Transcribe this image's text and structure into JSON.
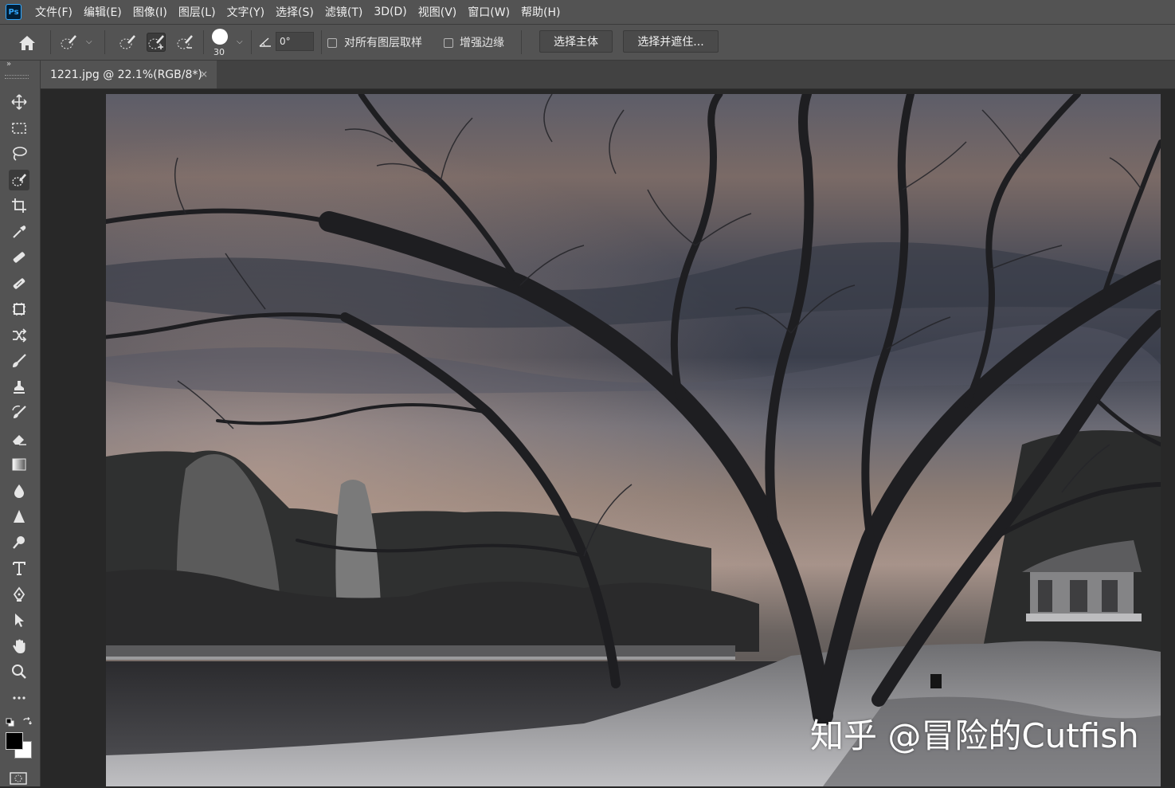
{
  "menubar": {
    "logo": "Ps",
    "items": [
      "文件(F)",
      "编辑(E)",
      "图像(I)",
      "图层(L)",
      "文字(Y)",
      "选择(S)",
      "滤镜(T)",
      "3D(D)",
      "视图(V)",
      "窗口(W)",
      "帮助(H)"
    ]
  },
  "options": {
    "brush_size": "30",
    "angle_value": "0°",
    "sample_all_layers_label": "对所有图层取样",
    "sample_all_layers_checked": false,
    "enhance_edge_label": "增强边缘",
    "enhance_edge_checked": false,
    "select_subject_label": "选择主体",
    "select_and_mask_label": "选择并遮住..."
  },
  "panel": {
    "collapse_glyph": "»"
  },
  "document": {
    "tab_title": "1221.jpg @ 22.1%(RGB/8*)",
    "close_glyph": "×"
  },
  "canvas": {
    "watermark": "知乎 @冒险的Cutfish"
  },
  "colors": {
    "foreground": "#000000",
    "background": "#ffffff"
  }
}
